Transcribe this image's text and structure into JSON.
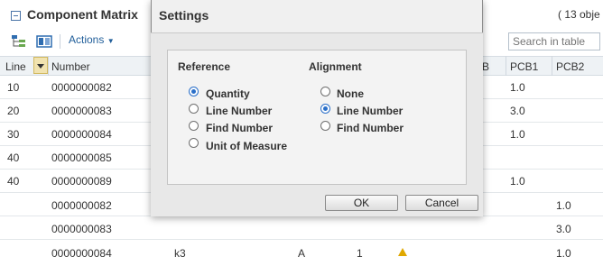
{
  "panel": {
    "title": "Component Matrix",
    "object_count": "( 13 obje",
    "actions_label": "Actions",
    "search_placeholder": "Search in table"
  },
  "table": {
    "headers": {
      "line": "Line",
      "number": "Number",
      "b_partial": "B",
      "pcb1": "PCB1",
      "pcb2": "PCB2"
    },
    "rows": [
      {
        "line": "10",
        "number": "0000000082",
        "pcb1": "1.0",
        "pcb2": ""
      },
      {
        "line": "20",
        "number": "0000000083",
        "pcb1": "3.0",
        "pcb2": ""
      },
      {
        "line": "30",
        "number": "0000000084",
        "pcb1": "1.0",
        "pcb2": ""
      },
      {
        "line": "40",
        "number": "0000000085",
        "pcb1": "",
        "pcb2": ""
      },
      {
        "line": "40",
        "number": "0000000089",
        "pcb1": "1.0",
        "pcb2": ""
      },
      {
        "line": "",
        "number": "0000000082",
        "pcb1": "",
        "pcb2": "1.0"
      },
      {
        "line": "",
        "number": "0000000083",
        "pcb1": "",
        "pcb2": "3.0"
      },
      {
        "line": "",
        "number": "0000000084",
        "extra1": "k3",
        "extra2": "A",
        "extra3": "1",
        "pcb1": "",
        "pcb2": "1.0"
      }
    ]
  },
  "dialog": {
    "title": "Settings",
    "reference": {
      "title": "Reference",
      "options": [
        "Quantity",
        "Line Number",
        "Find Number",
        "Unit of Measure"
      ],
      "selected": "Quantity"
    },
    "alignment": {
      "title": "Alignment",
      "options": [
        "None",
        "Line Number",
        "Find Number"
      ],
      "selected": "Line Number"
    },
    "ok_label": "OK",
    "cancel_label": "Cancel"
  },
  "colors": {
    "accent": "#2a6fc9",
    "link": "#1f5d99",
    "warning": "#e0a800"
  }
}
